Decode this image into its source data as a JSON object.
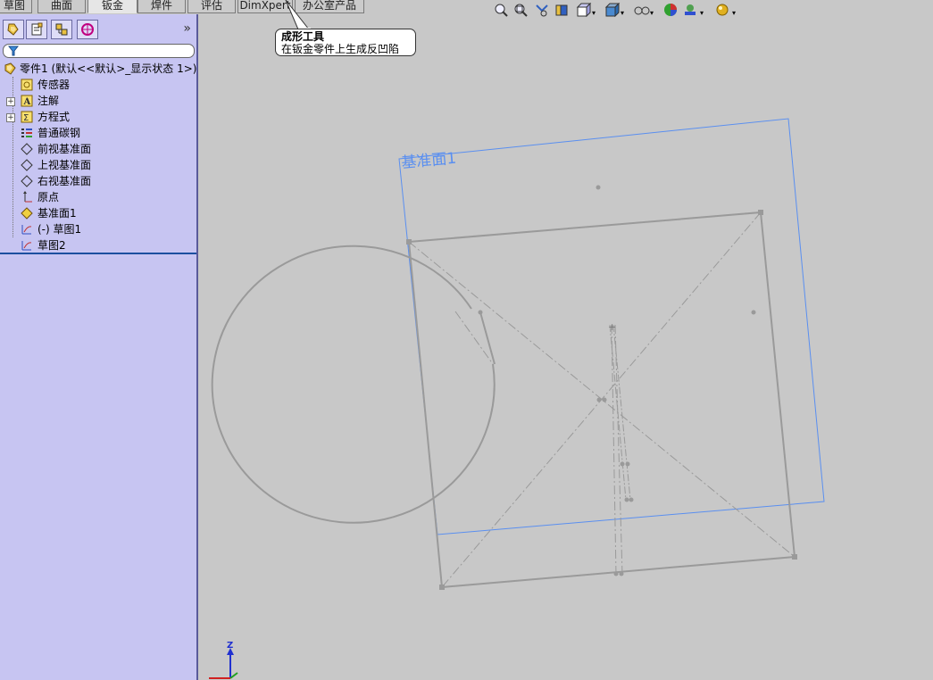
{
  "tabs": [
    {
      "label": "草图"
    },
    {
      "label": "曲面"
    },
    {
      "label": "钣金"
    },
    {
      "label": "焊件"
    },
    {
      "label": "评估"
    },
    {
      "label": "DimXpert"
    },
    {
      "label": "办公室产品"
    }
  ],
  "active_tab": "钣金",
  "tooltip": {
    "title": "成形工具",
    "description": "在钣金零件上生成反凹陷"
  },
  "feature_tree": {
    "root": "零件1  (默认<<默认>_显示状态 1>)",
    "items": [
      {
        "label": "传感器",
        "icon": "sensor-icon"
      },
      {
        "label": "注解",
        "icon": "annotation-icon"
      },
      {
        "label": "方程式",
        "icon": "equation-icon"
      },
      {
        "label": "普通碳钢",
        "icon": "material-icon"
      },
      {
        "label": "前视基准面",
        "icon": "plane-icon"
      },
      {
        "label": "上视基准面",
        "icon": "plane-icon"
      },
      {
        "label": "右视基准面",
        "icon": "plane-icon"
      },
      {
        "label": "原点",
        "icon": "origin-icon"
      },
      {
        "label": "基准面1",
        "icon": "plane-feature-icon"
      },
      {
        "label": "(-) 草图1",
        "icon": "sketch-icon"
      },
      {
        "label": "草图2",
        "icon": "sketch-icon"
      }
    ],
    "collapse_label": "»"
  },
  "viewport": {
    "plane_label": "基准面1",
    "triad_label": "Z"
  },
  "colors": {
    "panel_bg": "#c7c5f2",
    "viewport_bg": "#c8c8c8",
    "plane_color": "#5a8ff0",
    "sketch_color": "#9a9a9a"
  }
}
